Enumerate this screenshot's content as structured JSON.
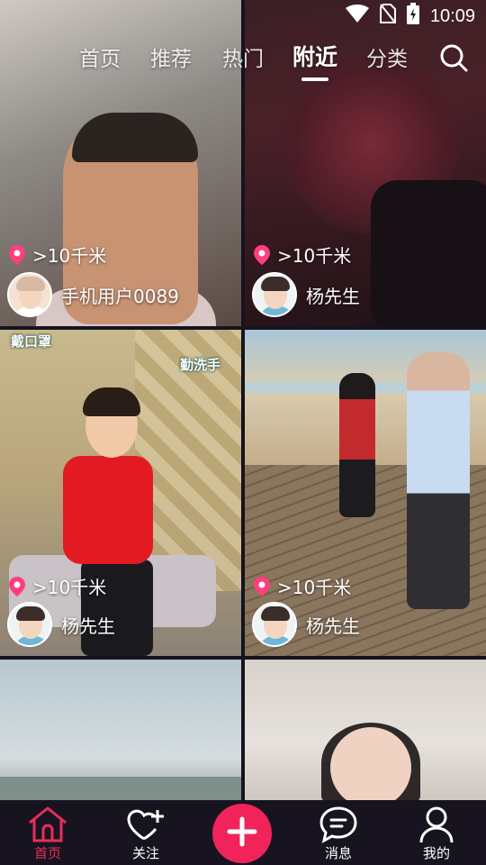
{
  "status_bar": {
    "time": "10:09"
  },
  "top_tabs": [
    {
      "label": "首页",
      "active": false
    },
    {
      "label": "推荐",
      "active": false
    },
    {
      "label": "热门",
      "active": false
    },
    {
      "label": "附近",
      "active": true
    },
    {
      "label": "分类",
      "active": false
    }
  ],
  "feed": [
    {
      "distance": ">10千米",
      "username": "手机用户0089"
    },
    {
      "distance": ">10千米",
      "username": "杨先生"
    },
    {
      "distance": ">10千米",
      "username": "杨先生",
      "sticker_top": "戴口罩",
      "sticker_right": "勤洗手"
    },
    {
      "distance": ">10千米",
      "username": "杨先生"
    }
  ],
  "bottom_nav": [
    {
      "label": "首页",
      "icon": "home-icon",
      "active": true
    },
    {
      "label": "关注",
      "icon": "heart-plus-icon",
      "active": false
    },
    {
      "label": "",
      "icon": "plus-icon",
      "active": false
    },
    {
      "label": "消息",
      "icon": "message-icon",
      "active": false
    },
    {
      "label": "我的",
      "icon": "profile-icon",
      "active": false
    }
  ],
  "colors": {
    "accent": "#f0245a",
    "nav_bg": "#18141f",
    "active_nav": "#e62e5c"
  }
}
